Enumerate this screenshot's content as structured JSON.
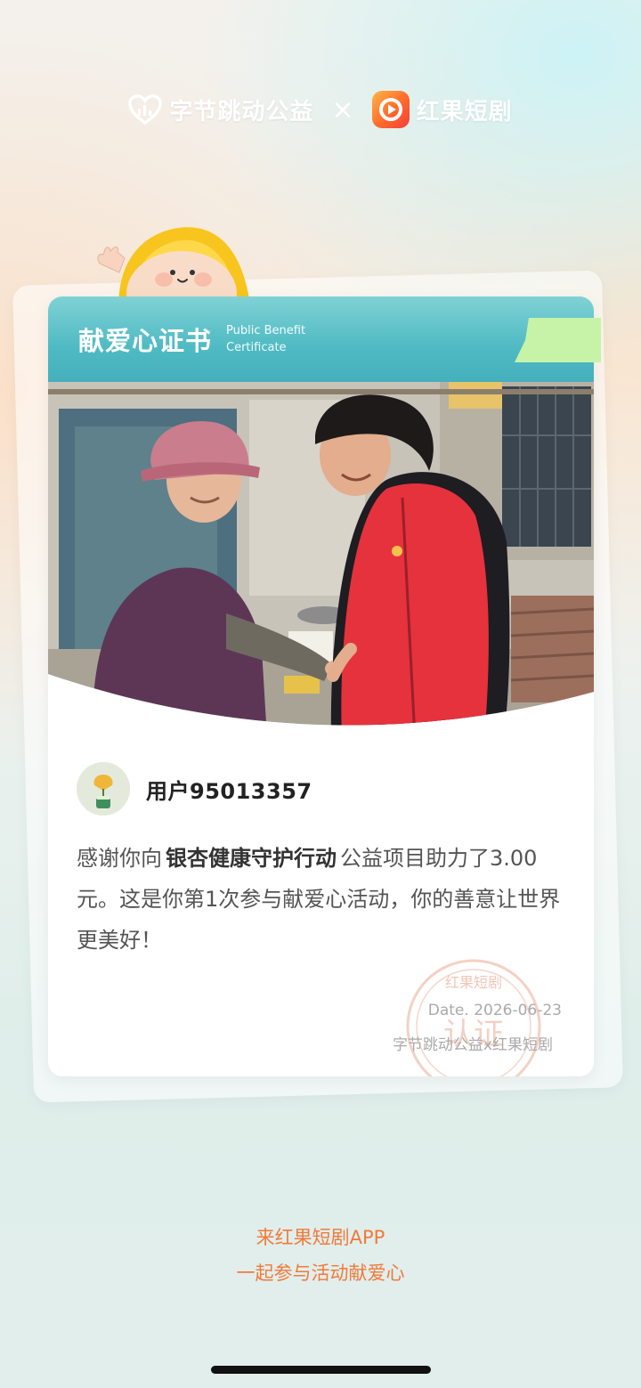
{
  "header": {
    "brand_left": "字节跳动公益",
    "times": "×",
    "brand_right": "红果短剧"
  },
  "certificate": {
    "title": "献爱心证书",
    "subtitle_line1": "Public Benefit",
    "subtitle_line2": "Certificate"
  },
  "user": {
    "name": "用户95013357"
  },
  "message": {
    "pre": "感谢你向",
    "project": "银杏健康守护行动",
    "post": "公益项目助力了3.00元。这是你第1次参与献爱心活动，你的善意让世界更美好！"
  },
  "stamp": {
    "top_text": "红果短剧",
    "center_text": "认证"
  },
  "date": "Date. 2026-06-23",
  "signature": "字节跳动公益x红果短剧",
  "footer": {
    "line1": "来红果短剧APP",
    "line2": "一起参与活动献爱心"
  },
  "colors": {
    "banner": "#4fbac3",
    "footer_text": "#f07a3a",
    "ribbon": "#c6f3a8"
  }
}
